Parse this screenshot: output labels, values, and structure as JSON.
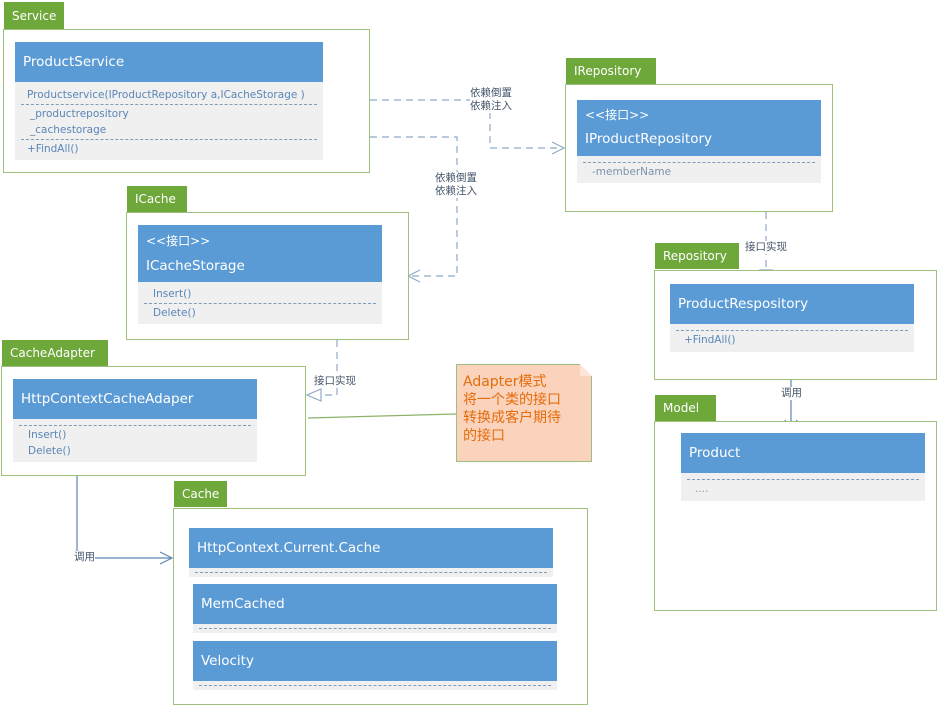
{
  "packages": {
    "service": "Service",
    "irepository": "IRepository",
    "icache": "ICache",
    "repository": "Repository",
    "cacheadapter": "CacheAdapter",
    "model": "Model",
    "cache": "Cache"
  },
  "classes": {
    "product_service": {
      "name": "ProductService",
      "constructor": "Productservice(IProductRepository a,ICacheStorage )",
      "fields": [
        "_productrepository",
        "_cachestorage"
      ],
      "methods": [
        "+FindAll()"
      ]
    },
    "iproduct_repository": {
      "stereotype": "<<接口>>",
      "name": "IProductRepository",
      "fields": [
        "-memberName"
      ]
    },
    "icache_storage": {
      "stereotype": "<<接口>>",
      "name": "ICacheStorage",
      "methods": [
        "Insert()",
        "Delete()"
      ]
    },
    "product_respository": {
      "name": "ProductRespository",
      "methods": [
        "+FindAll()"
      ]
    },
    "http_context_cache_adaper": {
      "name": "HttpContextCacheAdaper",
      "methods": [
        "Insert()",
        "Delete()"
      ]
    },
    "product": {
      "name": "Product",
      "fields": [
        "...."
      ]
    },
    "cache_impls": [
      "HttpContext.Current.Cache",
      "MemCached",
      "Velocity"
    ]
  },
  "connectors": {
    "dip_line1": "依赖倒置",
    "dip_line2": "依赖注入",
    "interface_impl": "接口实现",
    "call": "调用"
  },
  "note": {
    "lines": [
      "Adapter模式",
      "将一个类的接口",
      "转换成客户期待",
      "的接口"
    ]
  },
  "colors": {
    "package_tab": "#6fa83a",
    "package_border": "#9dc07f",
    "class_header": "#5b9bd5",
    "class_body": "#f0f0f0",
    "note_fill": "#fbd3bd",
    "note_text": "#e46c0a",
    "connector": "#7f9db9"
  }
}
